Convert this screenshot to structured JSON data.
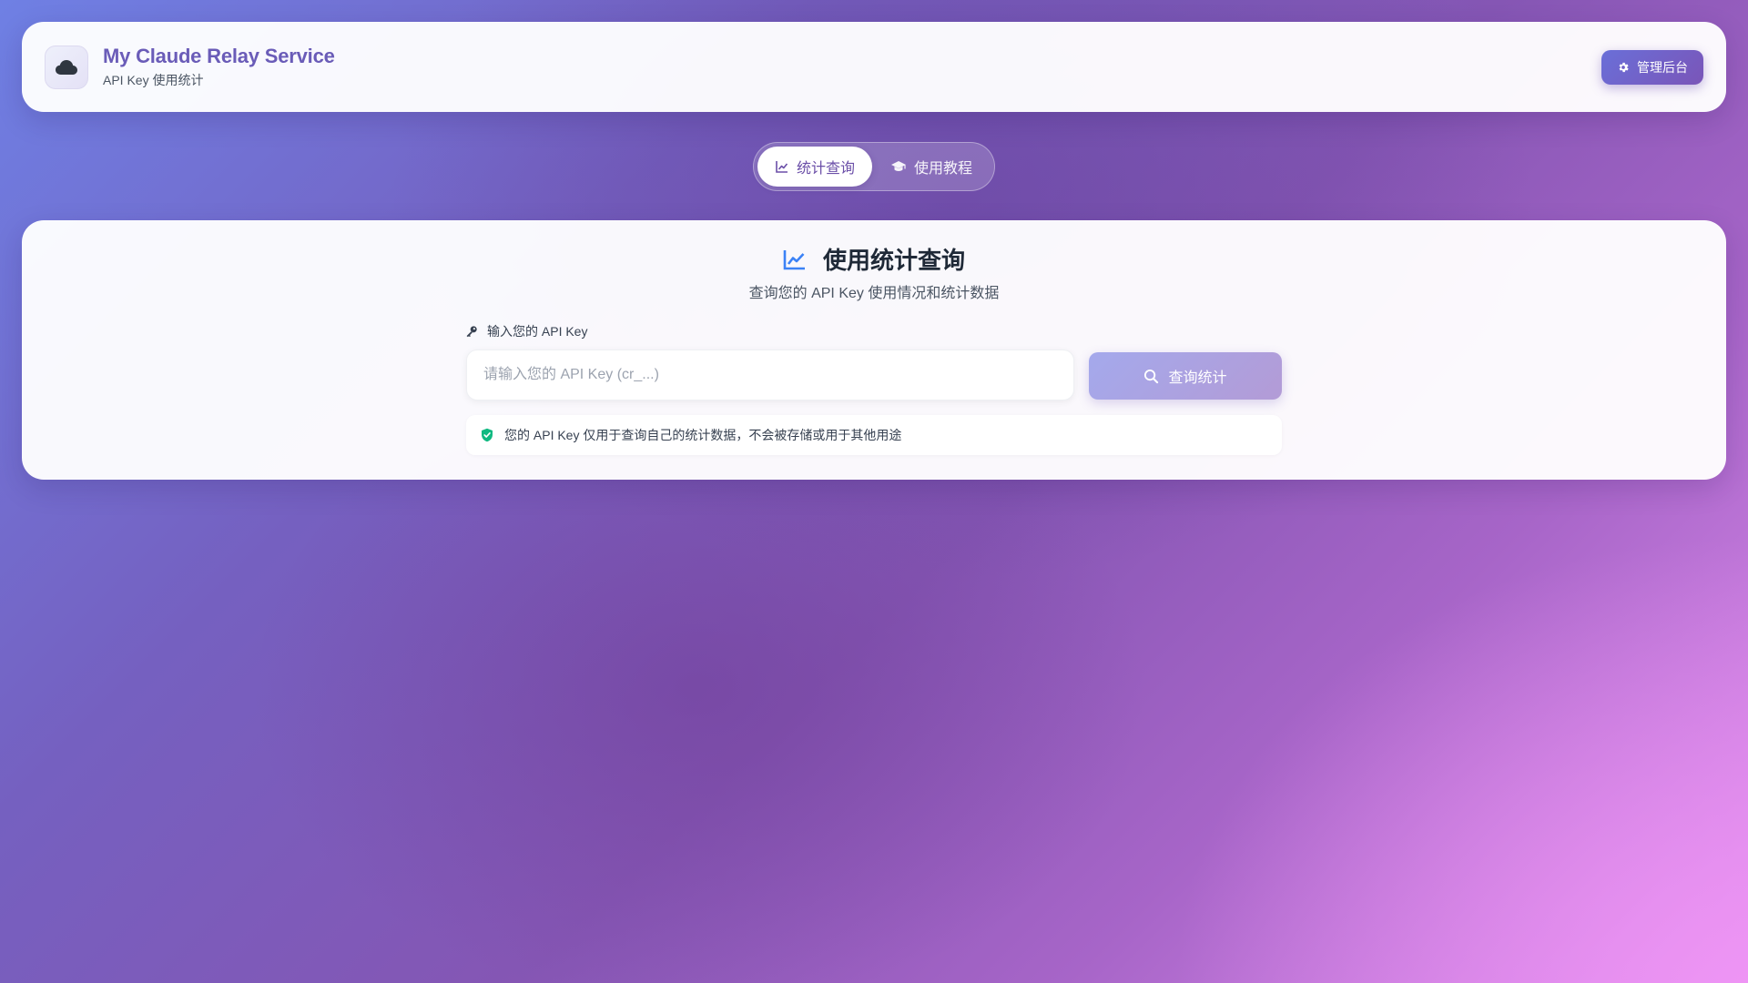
{
  "header": {
    "title": "My Claude Relay Service",
    "subtitle": "API Key 使用统计",
    "logo_icon": "cloud-icon",
    "admin_button": {
      "label": "管理后台",
      "icon": "gear-icon"
    }
  },
  "tabs": [
    {
      "label": "统计查询",
      "icon": "line-chart-icon",
      "active": true
    },
    {
      "label": "使用教程",
      "icon": "graduation-cap-icon",
      "active": false
    }
  ],
  "main": {
    "title": "使用统计查询",
    "title_icon": "line-chart-icon",
    "description": "查询您的 API Key 使用情况和统计数据",
    "input_label": "输入您的 API Key",
    "input_icon": "key-icon",
    "input_placeholder": "请输入您的 API Key (cr_...)",
    "input_value": "",
    "query_button": {
      "label": "查询统计",
      "icon": "search-icon"
    },
    "notice": {
      "icon": "shield-check-icon",
      "text": "您的 API Key 仅用于查询自己的统计数据，不会被存储或用于其他用途"
    }
  },
  "colors": {
    "brand_title": "#6a5cb8",
    "button_gradient_start": "#6a6fd8",
    "button_gradient_end": "#7a55b8",
    "chart_icon_blue": "#3b82f6",
    "shield_green": "#10b981"
  }
}
